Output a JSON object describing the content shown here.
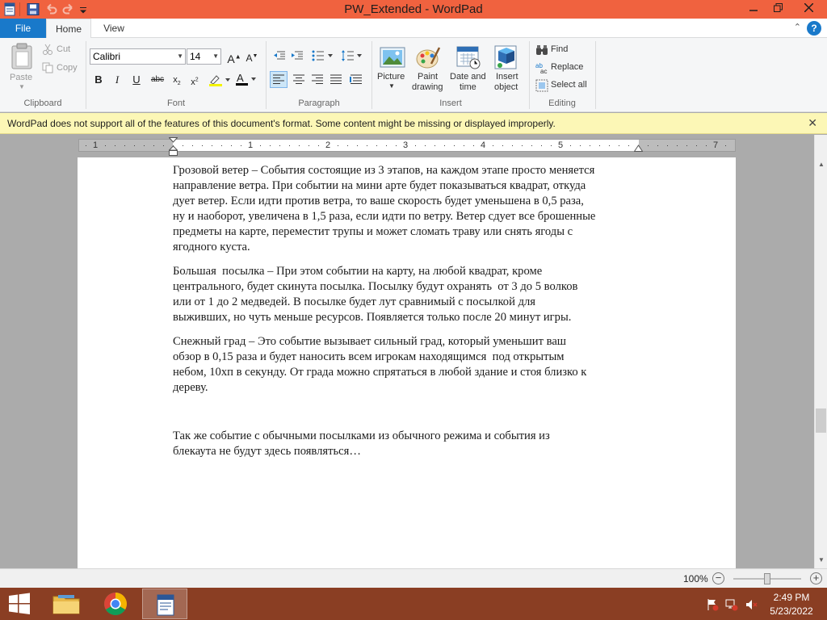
{
  "window": {
    "title": "PW_Extended - WordPad",
    "accent": "#f0623f"
  },
  "tabs": {
    "file": "File",
    "home": "Home",
    "view": "View"
  },
  "clipboard": {
    "paste": "Paste",
    "cut": "Cut",
    "copy": "Copy",
    "label": "Clipboard"
  },
  "font": {
    "family": "Calibri",
    "size": "14",
    "label": "Font"
  },
  "paragraph": {
    "label": "Paragraph"
  },
  "insert": {
    "picture": "Picture",
    "paint1": "Paint",
    "paint2": "drawing",
    "date1": "Date and",
    "date2": "time",
    "obj1": "Insert",
    "obj2": "object",
    "label": "Insert"
  },
  "editing": {
    "find": "Find",
    "replace": "Replace",
    "select_all": "Select all",
    "label": "Editing"
  },
  "infobar": {
    "message": "WordPad does not support all of the features of this document's format. Some content might be missing or displayed improperly."
  },
  "ruler": {
    "numbers": [
      "1",
      "1",
      "2",
      "3",
      "4",
      "5",
      "7"
    ]
  },
  "document": {
    "paragraphs": [
      [
        "Грозовой ветер – События состоящие из 3 этапов, на каждом этапе просто меняется",
        "направление ветра. При событии на мини арте будет показываться квадрат, откуда",
        "дует ветер. Если идти против ветра, то ваше скорость будет уменьшена в 0,5 раза,",
        "ну и наоборот, увеличена в 1,5 раза, если идти по ветру. Ветер сдует все брошенные",
        "предметы на карте, переместит трупы и может сломать траву или снять ягоды с",
        "ягодного куста."
      ],
      [
        "Большая  посылка – При этом событии на карту, на любой квадрат, кроме",
        "центрального, будет скинута посылка. Посылку будут охранять  от 3 до 5 волков",
        "или от 1 до 2 медведей. В посылке будет лут сравнимый с посылкой для",
        "выживших, но чуть меньше ресурсов. Появляется только после 20 минут игры."
      ],
      [
        "Снежный град – Это событие вызывает сильный град, который уменьшит ваш",
        "обзор в 0,15 раза и будет наносить всем игрокам находящимся  под открытым",
        "небом, 10хп в секунду. От града можно спрятаться в любой здание и стоя близко к",
        "дереву."
      ],
      [
        "Так же событие с обычными посылками из обычного режима и события из",
        "блекаута не будут здесь появляться…"
      ]
    ]
  },
  "status": {
    "zoom": "100%",
    "zoom_level": 1.0
  },
  "taskbar": {
    "time": "2:49 PM",
    "date": "5/23/2022",
    "color": "#8a3e23"
  }
}
